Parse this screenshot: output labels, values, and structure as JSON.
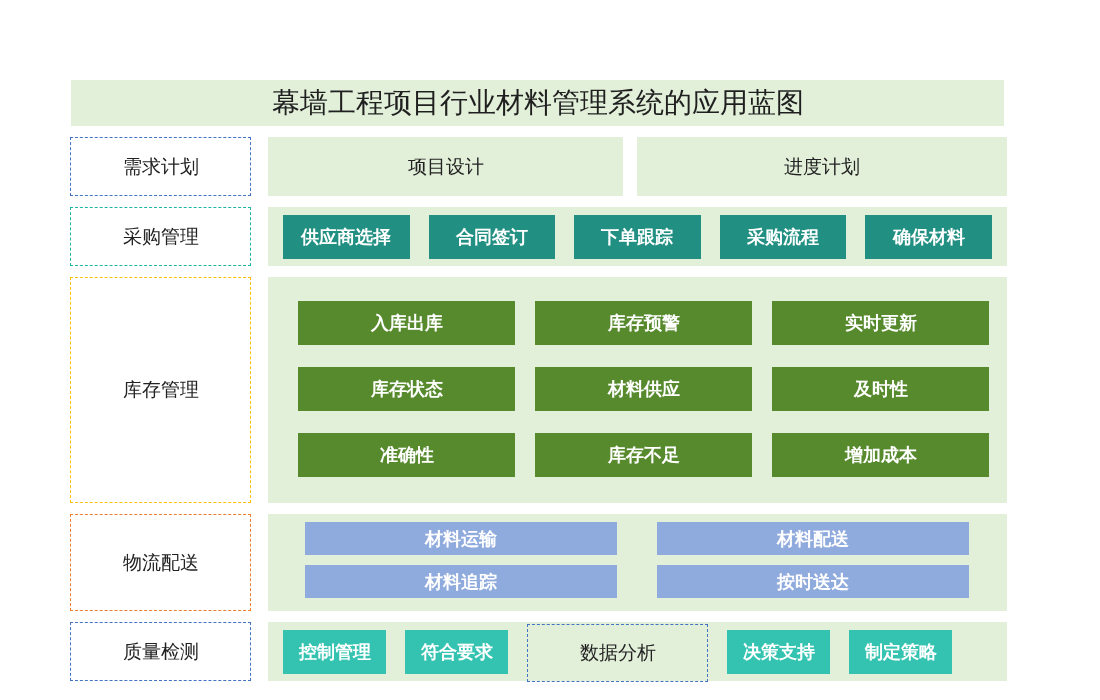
{
  "title": "幕墙工程项目行业材料管理系统的应用蓝图",
  "rows": [
    {
      "label": "需求计划",
      "color": "#4472c4",
      "kind": "split",
      "items": [
        {
          "text": "项目设计",
          "kind": "panel"
        },
        {
          "text": "进度计划",
          "kind": "panel"
        }
      ]
    },
    {
      "label": "采购管理",
      "color": "#1fb5a5",
      "kind": "row",
      "items": [
        {
          "text": "供应商选择",
          "kind": "teal"
        },
        {
          "text": "合同签订",
          "kind": "teal"
        },
        {
          "text": "下单跟踪",
          "kind": "teal"
        },
        {
          "text": "采购流程",
          "kind": "teal"
        },
        {
          "text": "确保材料",
          "kind": "teal"
        }
      ]
    },
    {
      "label": "库存管理",
      "color": "#ffc000",
      "kind": "grid",
      "items": [
        {
          "text": "入库出库",
          "kind": "green"
        },
        {
          "text": "库存预警",
          "kind": "green"
        },
        {
          "text": "实时更新",
          "kind": "green"
        },
        {
          "text": "库存状态",
          "kind": "green"
        },
        {
          "text": "材料供应",
          "kind": "green"
        },
        {
          "text": "及时性",
          "kind": "green"
        },
        {
          "text": "准确性",
          "kind": "green"
        },
        {
          "text": "库存不足",
          "kind": "green"
        },
        {
          "text": "增加成本",
          "kind": "green"
        }
      ]
    },
    {
      "label": "物流配送",
      "color": "#ed7d31",
      "kind": "pairs",
      "items": [
        {
          "text": "材料运输",
          "kind": "blue"
        },
        {
          "text": "材料配送",
          "kind": "blue"
        },
        {
          "text": "材料追踪",
          "kind": "blue"
        },
        {
          "text": "按时送达",
          "kind": "blue"
        }
      ]
    },
    {
      "label": "质量检测",
      "color": "#4472c4",
      "kind": "row",
      "items": [
        {
          "text": "控制管理",
          "kind": "cyan"
        },
        {
          "text": "符合要求",
          "kind": "cyan"
        },
        {
          "text": "数据分析",
          "kind": "dashed"
        },
        {
          "text": "决策支持",
          "kind": "cyan"
        },
        {
          "text": "制定策略",
          "kind": "cyan"
        }
      ]
    }
  ]
}
